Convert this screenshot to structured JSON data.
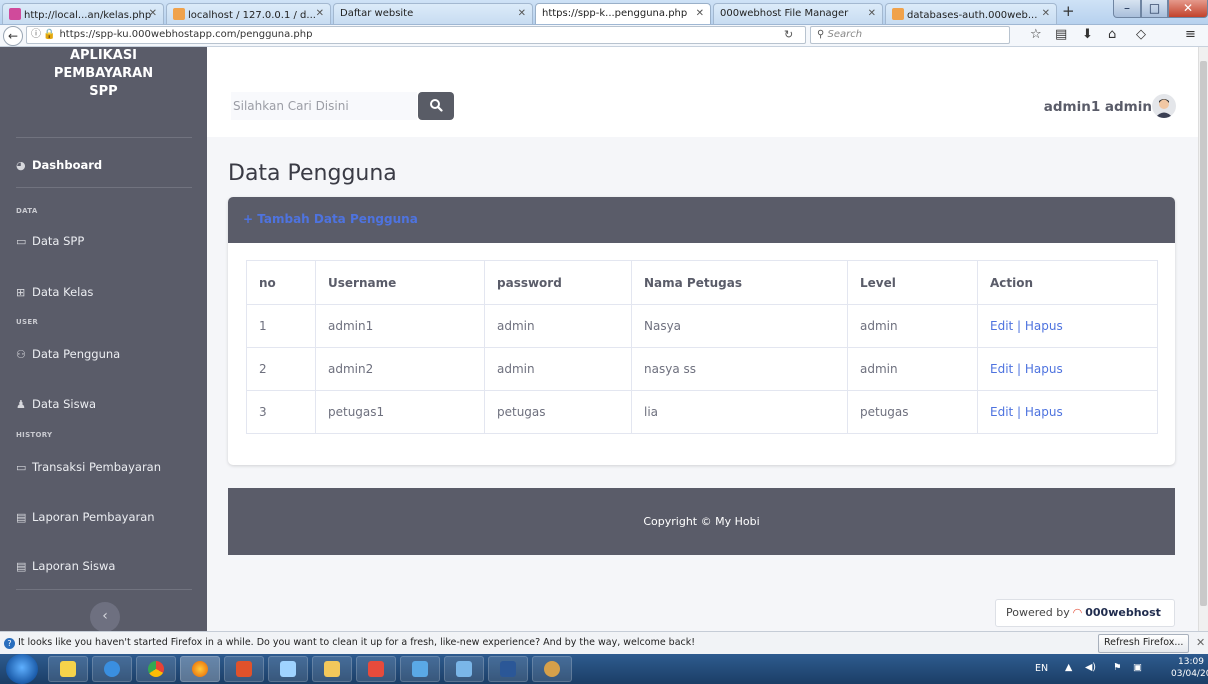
{
  "browser": {
    "tabs": [
      {
        "label": "http://local...an/kelas.php",
        "color": "#d04a9b"
      },
      {
        "label": "localhost / 127.0.0.1 / d...",
        "color": "#f0a24b"
      },
      {
        "label": "Daftar website",
        "color": ""
      },
      {
        "label": "https://spp-k...pengguna.php",
        "color": ""
      },
      {
        "label": "000webhost File Manager",
        "color": ""
      },
      {
        "label": "databases-auth.000web...",
        "color": "#f0a24b"
      }
    ],
    "active_tab": 3,
    "url": "https://spp-ku.000webhostapp.com/pengguna.php",
    "search_placeholder": "Search"
  },
  "sidebar": {
    "brand_line1": "APLIKASI",
    "brand_line2": "PEMBAYARAN",
    "brand_line3": "SPP",
    "dashboard": "Dashboard",
    "section_data": "DATA",
    "data_spp": "Data SPP",
    "data_kelas": "Data Kelas",
    "section_user": "USER",
    "data_pengguna": "Data Pengguna",
    "data_siswa": "Data Siswa",
    "section_history": "HISTORY",
    "transaksi": "Transaksi Pembayaran",
    "laporan_pembayaran": "Laporan Pembayaran",
    "laporan_siswa": "Laporan Siswa"
  },
  "topbar": {
    "search_placeholder": "Silahkan Cari Disini",
    "user_name": "admin1 admin"
  },
  "main": {
    "title": "Data Pengguna",
    "add_link": "+ Tambah Data Pengguna",
    "table": {
      "headers": [
        "no",
        "Username",
        "password",
        "Nama Petugas",
        "Level",
        "Action"
      ],
      "rows": [
        {
          "no": "1",
          "username": "admin1",
          "password": "admin",
          "nama": "Nasya",
          "level": "admin",
          "action": "Edit | Hapus"
        },
        {
          "no": "2",
          "username": "admin2",
          "password": "admin",
          "nama": "nasya ss",
          "level": "admin",
          "action": "Edit | Hapus"
        },
        {
          "no": "3",
          "username": "petugas1",
          "password": "petugas",
          "nama": "lia",
          "level": "petugas",
          "action": "Edit | Hapus"
        }
      ]
    },
    "footer": "Copyright © My Hobi",
    "powered_prefix": "Powered by",
    "powered_brand": "000webhost"
  },
  "notification": {
    "text": "It looks like you haven't started Firefox in a while. Do you want to clean it up for a fresh, like-new experience? And by the way, welcome back!",
    "button": "Refresh Firefox..."
  },
  "taskbar": {
    "lang": "EN",
    "time": "13:09",
    "date": "03/04/2021"
  },
  "colors": {
    "sidebar": "#5a5c69",
    "accent": "#4e73df",
    "page_bg": "#f5f6f9"
  }
}
